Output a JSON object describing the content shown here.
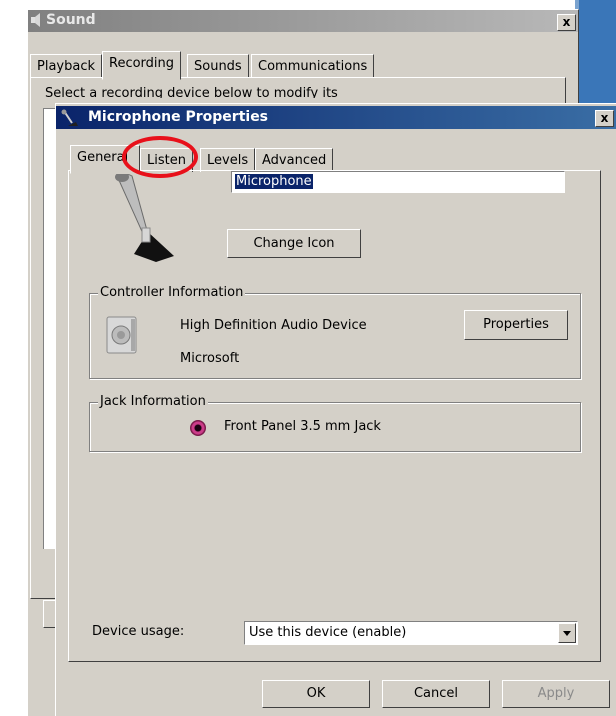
{
  "sound_window": {
    "title": "Sound",
    "tabs": [
      "Playback",
      "Recording",
      "Sounds",
      "Communications"
    ],
    "active_tab": "Recording",
    "caption": "Select a recording device below to modify its settings:",
    "close_label": "x"
  },
  "mic_dialog": {
    "title": "Microphone Properties",
    "close_label": "x",
    "tabs": [
      "General",
      "Listen",
      "Levels",
      "Advanced"
    ],
    "active_tab": "General",
    "device_name": "Microphone",
    "change_icon_label": "Change Icon",
    "controller": {
      "group_label": "Controller Information",
      "name": "High Definition Audio Device",
      "vendor": "Microsoft",
      "properties_label": "Properties"
    },
    "jack": {
      "group_label": "Jack Information",
      "label": "Front Panel 3.5 mm Jack",
      "color": "#cc3c8a"
    },
    "device_usage": {
      "label": "Device usage:",
      "value": "Use this device (enable)"
    },
    "buttons": {
      "ok": "OK",
      "cancel": "Cancel",
      "apply": "Apply"
    }
  },
  "annotation": {
    "highlighted_tab": "Listen",
    "color": "#e8101a"
  }
}
